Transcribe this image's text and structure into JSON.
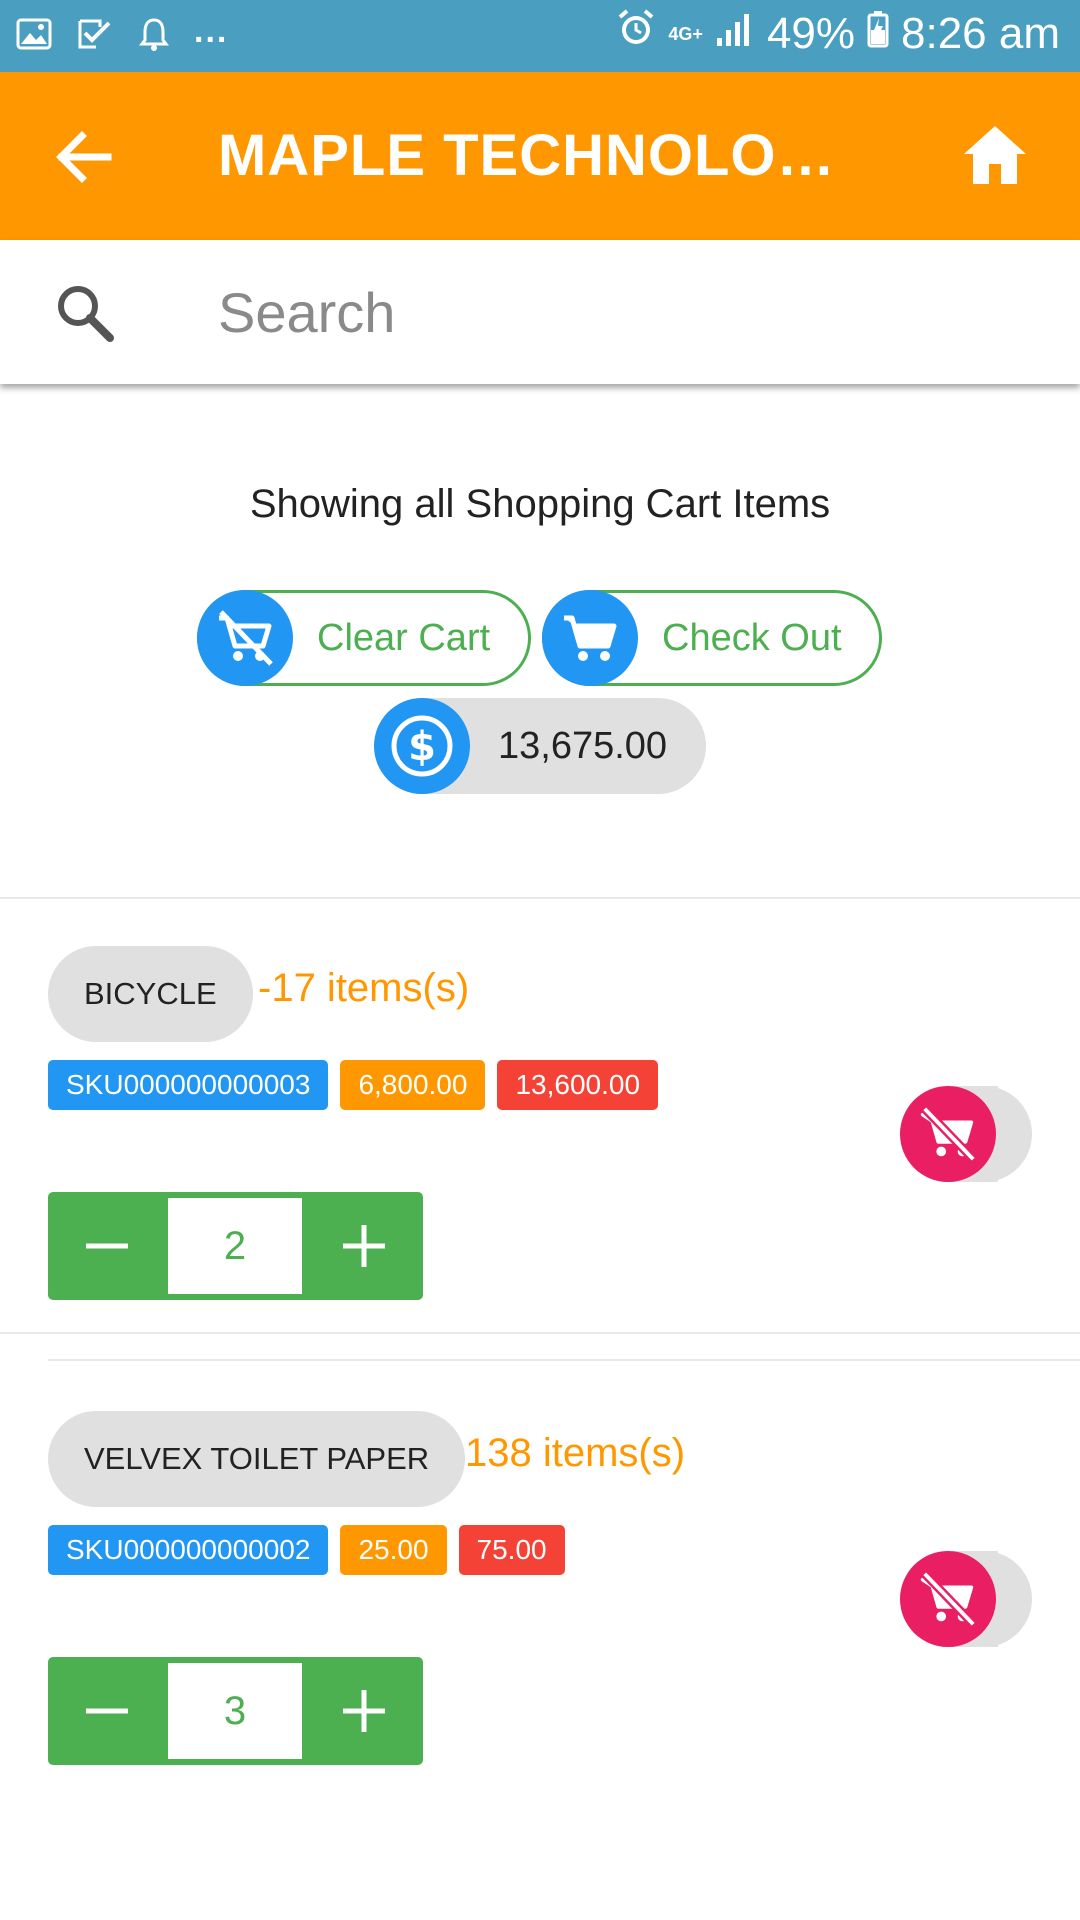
{
  "status_bar": {
    "dots": "...",
    "network": "4G+",
    "battery": "49%",
    "time": "8:26 am",
    "icons": [
      "image-icon",
      "check-icon",
      "bell-icon",
      "alarm-icon",
      "signal-icon",
      "battery-icon"
    ]
  },
  "app_bar": {
    "title": "MAPLE TECHNOLOGIES",
    "back_icon": "arrow-left-icon",
    "home_icon": "home-icon",
    "color": "#ff9800"
  },
  "search": {
    "placeholder": "Search",
    "value": ""
  },
  "cart": {
    "heading": "Showing all Shopping Cart Items",
    "clear_label": "Clear Cart",
    "checkout_label": "Check Out",
    "total": "13,675.00"
  },
  "items": [
    {
      "name": "BICYCLE",
      "count": "-17 items(s)",
      "sku": "SKU000000000003",
      "price": "6,800.00",
      "line_total": "13,600.00",
      "quantity": "2"
    },
    {
      "name": "VELVEX TOILET PAPER",
      "count": "138 items(s)",
      "sku": "SKU000000000002",
      "price": "25.00",
      "line_total": "75.00",
      "quantity": "3"
    }
  ],
  "colors": {
    "accent_green": "#4caf50",
    "blue": "#2196f3",
    "orange": "#ff9800",
    "red": "#f44336",
    "pink": "#e91e63"
  }
}
